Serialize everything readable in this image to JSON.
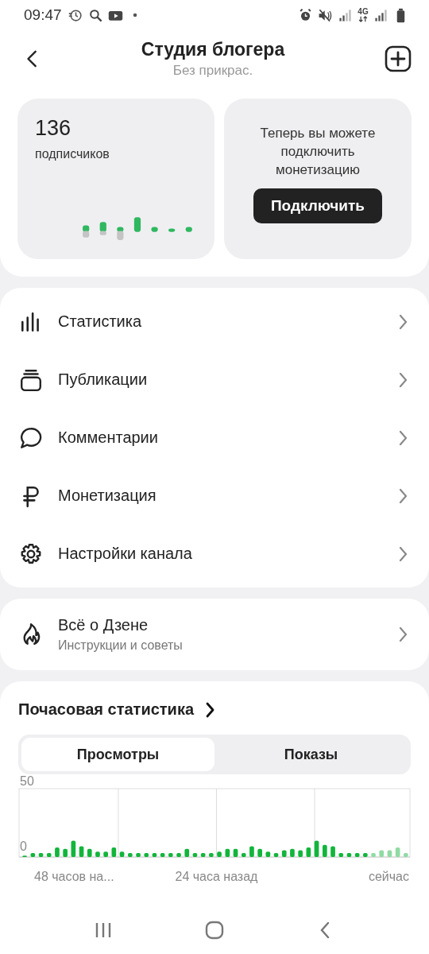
{
  "status_bar": {
    "time": "09:47",
    "network": "4G"
  },
  "header": {
    "title": "Студия блогера",
    "subtitle": "Без прикрас."
  },
  "subscribers": {
    "count": "136",
    "label": "подписчиков"
  },
  "monetization_card": {
    "text": "Теперь вы можете подключить монетизацию",
    "button": "Подключить"
  },
  "menu": [
    {
      "kind": "stats",
      "label": "Статистика"
    },
    {
      "kind": "publications",
      "label": "Публикации"
    },
    {
      "kind": "comments",
      "label": "Комментарии"
    },
    {
      "kind": "ruble",
      "label": "Монетизация"
    },
    {
      "kind": "gear",
      "label": "Настройки канала"
    }
  ],
  "about": {
    "title": "Всё о Дзене",
    "subtitle": "Инструкции и советы"
  },
  "hourly": {
    "title": "Почасовая статистика",
    "tabs": [
      {
        "label": "Просмотры",
        "selected": true
      },
      {
        "label": "Показы",
        "selected": false
      }
    ],
    "chart": {
      "y_labels": [
        "50",
        "0"
      ],
      "x_labels": [
        "48 часов на...",
        "24 часа назад",
        "сейчас"
      ]
    }
  }
}
